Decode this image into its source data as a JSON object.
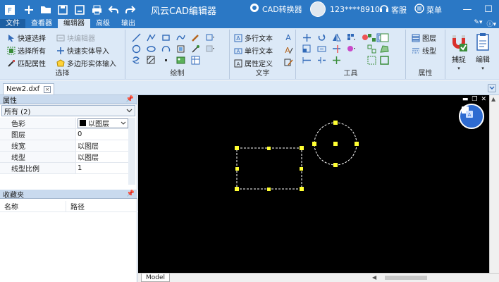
{
  "titlebar": {
    "title": "风云CAD编辑器",
    "converter_label": "CAD转换器",
    "username": "123****8910",
    "service_label": "客服",
    "menu_label": "菜单"
  },
  "menu_tabs": [
    "文件",
    "查看器",
    "编辑器",
    "高级",
    "输出"
  ],
  "active_tab": "编辑器",
  "ribbon": {
    "select_group": {
      "label": "选择",
      "items": [
        "快速选择",
        "选择所有",
        "匹配属性"
      ],
      "items2": [
        "块编辑器",
        "快速实体导入",
        "多边形实体输入"
      ]
    },
    "draw_group": {
      "label": "绘制"
    },
    "text_group": {
      "label": "文字",
      "items": [
        "多行文本",
        "单行文本",
        "属性定义"
      ]
    },
    "tools_group": {
      "label": "工具"
    },
    "props_group": {
      "label": "属性",
      "items": [
        "图层",
        "线型"
      ]
    },
    "capture_label": "捕捉",
    "edit_label": "编辑"
  },
  "doc_tab": {
    "name": "New2.dxf"
  },
  "properties_panel": {
    "title": "属性",
    "filter": "所有 (2)",
    "rows": [
      {
        "name": "色彩",
        "value": "以图层"
      },
      {
        "name": "图层",
        "value": "0"
      },
      {
        "name": "线宽",
        "value": "以图层"
      },
      {
        "name": "线型",
        "value": "以图层"
      },
      {
        "name": "线型比例",
        "value": "1"
      }
    ]
  },
  "favorites_panel": {
    "title": "收藏夹",
    "columns": [
      "名称",
      "路径"
    ]
  },
  "model_tab": "Model",
  "colors": {
    "titlebar": "#2b78c5",
    "ribbon_bg": "#dce9f7",
    "canvas_bg": "#000000",
    "grip": "#ffff33",
    "float_button": "#2e6bd1"
  }
}
